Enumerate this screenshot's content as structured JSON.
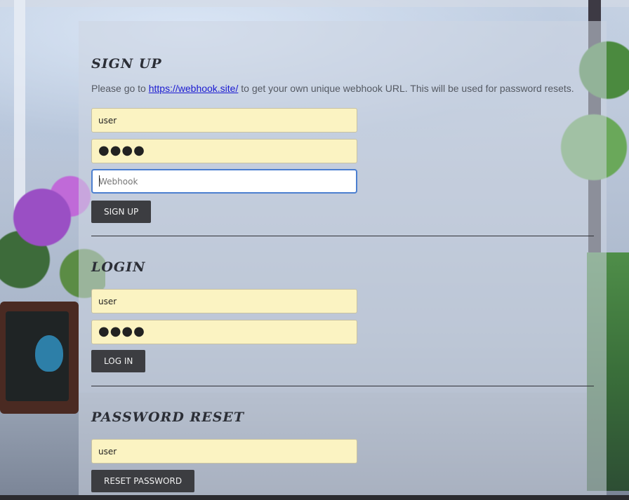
{
  "signup": {
    "heading": "SIGN UP",
    "note_before": "Please go to ",
    "note_link": "https://webhook.site/",
    "note_after": " to get your own unique webhook URL. This will be used for password resets.",
    "username_value": "user",
    "password_value": "●●●●",
    "webhook_placeholder": "Webhook",
    "button_label": "Sign up"
  },
  "login": {
    "heading": "LOGIN",
    "username_value": "user",
    "password_value": "●●●●",
    "button_label": "Log in"
  },
  "reset": {
    "heading": "PASSWORD RESET",
    "username_value": "user",
    "button_label": "Reset password"
  },
  "colors": {
    "input_fill": "#fbf3c2",
    "button_fill": "#3c3d41",
    "focus_ring": "#4c7fd0",
    "link": "#1a1ad1"
  }
}
